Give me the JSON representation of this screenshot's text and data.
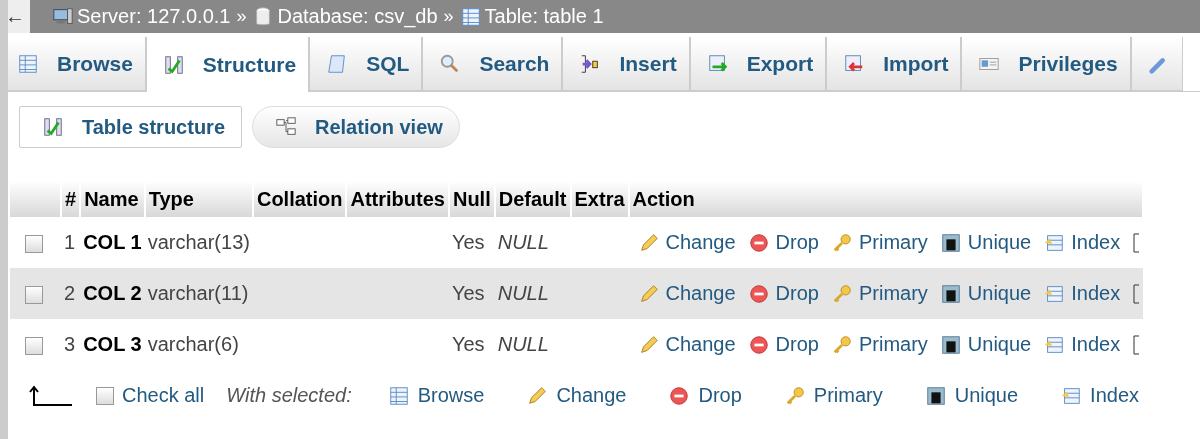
{
  "breadcrumb": {
    "back": "←",
    "separator": "»",
    "items": [
      {
        "kind": "server",
        "text": "Server: 127.0.0.1"
      },
      {
        "kind": "database",
        "text": "Database: csv_db"
      },
      {
        "kind": "table",
        "text": "Table: table 1"
      }
    ]
  },
  "tabs": [
    {
      "kind": "browse",
      "label": "Browse",
      "selected": false
    },
    {
      "kind": "structure",
      "label": "Structure",
      "selected": true
    },
    {
      "kind": "sql",
      "label": "SQL",
      "selected": false
    },
    {
      "kind": "search",
      "label": "Search",
      "selected": false
    },
    {
      "kind": "insert",
      "label": "Insert",
      "selected": false
    },
    {
      "kind": "export",
      "label": "Export",
      "selected": false
    },
    {
      "kind": "import",
      "label": "Import",
      "selected": false
    },
    {
      "kind": "privileges",
      "label": "Privileges",
      "selected": false
    },
    {
      "kind": "operations",
      "selected": false
    }
  ],
  "subtabs": [
    {
      "kind": "structure",
      "label": "Table structure",
      "selected": true
    },
    {
      "kind": "relation",
      "label": "Relation view",
      "selected": false
    }
  ],
  "table": {
    "columns": [
      "#",
      "Name",
      "Type",
      "Collation",
      "Attributes",
      "Null",
      "Default",
      "Extra",
      "Action"
    ],
    "rows": [
      {
        "checked": false,
        "number": "1",
        "name": "COL 1",
        "type": "varchar(13)",
        "null": "Yes",
        "default": "NULL",
        "actions": [
          {
            "kind": "change",
            "label": "Change"
          },
          {
            "kind": "drop",
            "label": "Drop"
          },
          {
            "kind": "primary",
            "label": "Primary"
          },
          {
            "kind": "unique",
            "label": "Unique"
          },
          {
            "kind": "index",
            "label": "Index"
          },
          {
            "kind": "more"
          }
        ]
      },
      {
        "checked": false,
        "number": "2",
        "name": "COL 2",
        "type": "varchar(11)",
        "null": "Yes",
        "default": "NULL",
        "actions": [
          {
            "kind": "change",
            "label": "Change"
          },
          {
            "kind": "drop",
            "label": "Drop"
          },
          {
            "kind": "primary",
            "label": "Primary"
          },
          {
            "kind": "unique",
            "label": "Unique"
          },
          {
            "kind": "index",
            "label": "Index"
          },
          {
            "kind": "more"
          }
        ]
      },
      {
        "checked": false,
        "number": "3",
        "name": "COL 3",
        "type": "varchar(6)",
        "null": "Yes",
        "default": "NULL",
        "actions": [
          {
            "kind": "change",
            "label": "Change"
          },
          {
            "kind": "drop",
            "label": "Drop"
          },
          {
            "kind": "primary",
            "label": "Primary"
          },
          {
            "kind": "unique",
            "label": "Unique"
          },
          {
            "kind": "index",
            "label": "Index"
          },
          {
            "kind": "more"
          }
        ]
      }
    ]
  },
  "footer": {
    "check_all": {
      "label": "Check all",
      "checked": false
    },
    "with_selected": "With selected:",
    "actions": [
      {
        "kind": "browse",
        "label": "Browse"
      },
      {
        "kind": "change",
        "label": "Change"
      },
      {
        "kind": "drop",
        "label": "Drop"
      },
      {
        "kind": "primary",
        "label": "Primary"
      },
      {
        "kind": "unique",
        "label": "Unique"
      },
      {
        "kind": "index",
        "label": "Index"
      }
    ]
  }
}
